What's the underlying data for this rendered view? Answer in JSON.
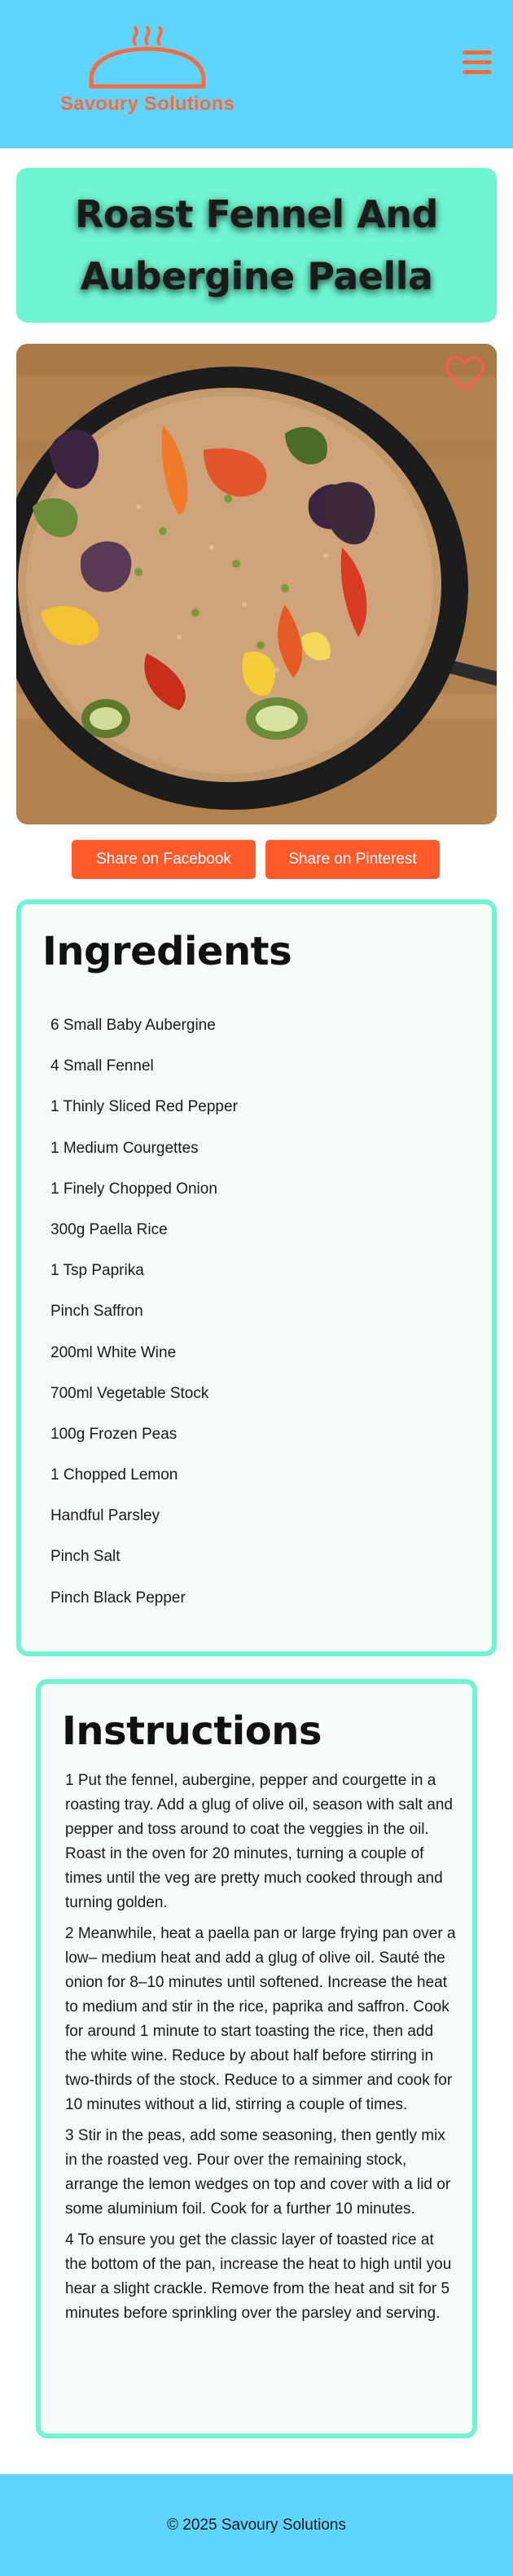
{
  "header": {
    "brand": "Savoury Solutions",
    "logo_icon": "covered-dish-icon",
    "menu_icon": "hamburger-menu-icon"
  },
  "recipe": {
    "title_line1": "Roast Fennel And",
    "title_line2": "Aubergine Paella",
    "photo_alt": "Roast fennel and aubergine paella in a black pan",
    "favorite_icon": "heart-icon"
  },
  "share": {
    "facebook_label": "Share on Facebook",
    "pinterest_label": "Share on Pinterest"
  },
  "ingredients": {
    "heading": "Ingredients",
    "items": [
      "6 Small Baby Aubergine",
      "4 Small Fennel",
      "1 Thinly Sliced Red Pepper",
      "1 Medium Courgettes",
      "1 Finely Chopped Onion",
      "300g Paella Rice",
      "1 Tsp Paprika",
      "Pinch Saffron",
      "200ml White Wine",
      "700ml Vegetable Stock",
      "100g Frozen Peas",
      "1 Chopped Lemon",
      "Handful Parsley",
      "Pinch Salt",
      "Pinch Black Pepper"
    ]
  },
  "instructions": {
    "heading": "Instructions",
    "steps": [
      "1 Put the fennel, aubergine, pepper and courgette in a roasting tray. Add a glug of olive oil, season with salt and pepper and toss around to coat the veggies in the oil. Roast in the oven for 20 minutes, turning a couple of times until the veg are pretty much cooked through and turning golden.",
      "2 Meanwhile, heat a paella pan or large frying pan over a low– medium heat and add a glug of olive oil. Sauté the onion for 8–10 minutes until softened. Increase the heat to medium and stir in the rice, paprika and saffron. Cook for around 1 minute to start toasting the rice, then add the white wine. Reduce by about half before stirring in two-thirds of the stock. Reduce to a simmer and cook for 10 minutes without a lid, stirring a couple of times.",
      "3 Stir in the peas, add some seasoning, then gently mix in the roasted veg. Pour over the remaining stock, arrange the lemon wedges on top and cover with a lid or some aluminium foil. Cook for a further 10 minutes.",
      "4 To ensure you get the classic layer of toasted rice at the bottom of the pan, increase the heat to high until you hear a slight crackle. Remove from the heat and sit for 5 minutes before sprinkling over the parsley and serving."
    ]
  },
  "footer": {
    "copyright": "© 2025 Savoury Solutions"
  },
  "colors": {
    "header_bg": "#5fd4ff",
    "accent_orange": "#ff6a3d",
    "share_button": "#ff5a2c",
    "card_mint": "#6ff5d0",
    "card_bg": "#f7fbfa"
  }
}
